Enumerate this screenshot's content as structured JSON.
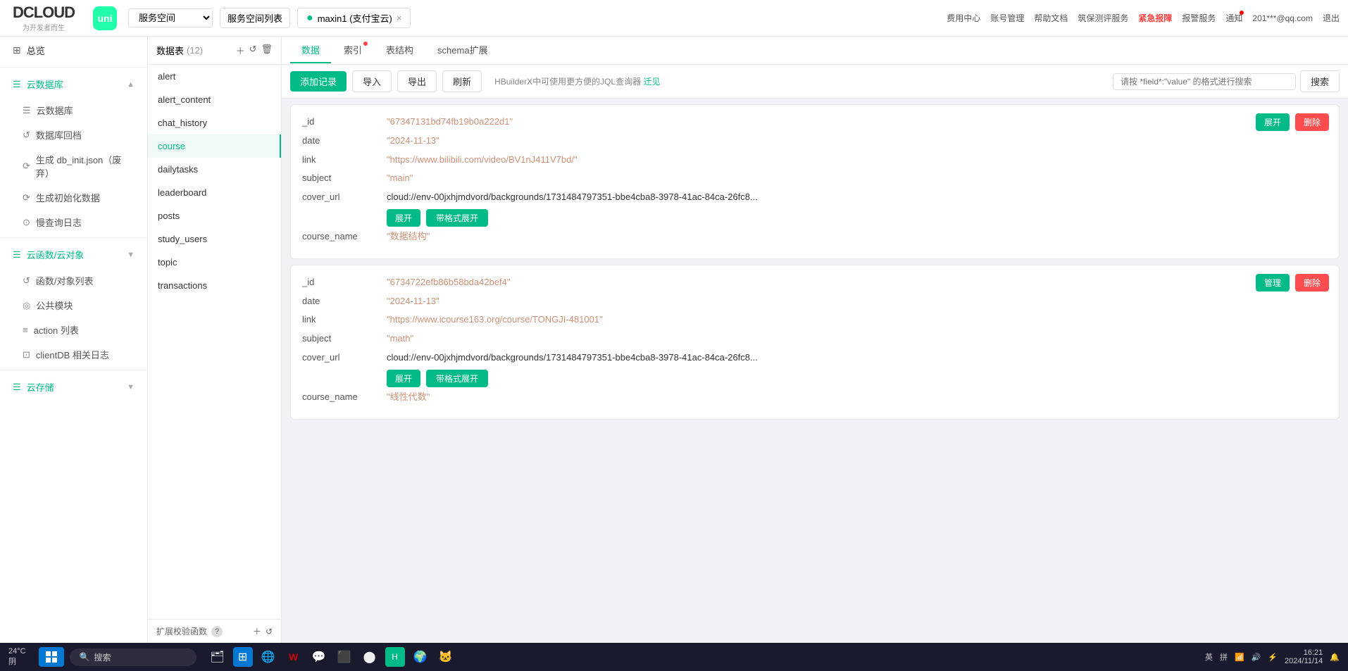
{
  "topbar": {
    "logo": "DCLOUD",
    "logo_sub": "为开发者而生",
    "uni_label": "uni",
    "workspace_label": "服务空间",
    "space_list_btn": "服务空间列表",
    "tab_active": "maxin1 (支付宝云)",
    "tab_close": "×",
    "nav_items": [
      "费用中心",
      "账号管理",
      "帮助文档",
      "筑保测评服务",
      "紧急报障",
      "报警服务",
      "通知",
      "201***@qq.com",
      "退出"
    ],
    "urgent_label": "紧急报障"
  },
  "sidebar": {
    "overview": "总览",
    "cloud_db_section": "云数据库",
    "cloud_db_label": "云数据库",
    "db_backup": "数据库回档",
    "gen_db_init": "生成 db_init.json（废弃）",
    "gen_init_data": "生成初始化数据",
    "slow_query_log": "慢查询日志",
    "cloud_func_section": "云函数/云对象",
    "func_list": "函数/对象列表",
    "public_module": "公共模块",
    "action_list": "action 列表",
    "client_db_log": "clientDB 相关日志",
    "cloud_storage": "云存储"
  },
  "table_list": {
    "header": "数据表",
    "count": "(12)",
    "tables": [
      "alert",
      "alert_content",
      "chat_history",
      "course",
      "dailytasks",
      "leaderboard",
      "posts",
      "study_users",
      "topic",
      "transactions"
    ],
    "active_table": "course",
    "expand_func_label": "扩展校验函数",
    "help_icon": "?"
  },
  "tabs": [
    {
      "label": "数据",
      "active": true,
      "has_dot": false
    },
    {
      "label": "索引",
      "active": false,
      "has_dot": true
    },
    {
      "label": "表结构",
      "active": false,
      "has_dot": false
    },
    {
      "label": "schema扩展",
      "active": false,
      "has_dot": false
    }
  ],
  "toolbar": {
    "add_record": "添加记录",
    "import": "导入",
    "export": "导出",
    "refresh": "刷新",
    "hint": "HBuilderX中可使用更方便的JQL查询器",
    "hint_link": "迁见",
    "search_placeholder": "请按 *field*:\"value\" 的格式进行搜索",
    "search_btn": "搜索"
  },
  "records": [
    {
      "id": "_id",
      "id_val": "\"67347131bd74fb19b0a222d1\"",
      "fields": [
        {
          "key": "date",
          "value": "\"2024-11-13\""
        },
        {
          "key": "link",
          "value": "\"https://www.bilibili.com/video/BV1nJ411V7bd/\""
        },
        {
          "key": "subject",
          "value": "\"main\""
        },
        {
          "key": "cover_url",
          "value": "cloud://env-00jxhjmdvord/backgrounds/1731484797351-bbe4cba8-3978-41ac-84ca-26fc8..."
        }
      ],
      "expand_btn": "展开",
      "expand_fmt_btn": "带格式展开",
      "course_name_key": "course_name",
      "course_name_val": "\"数据结构\""
    },
    {
      "id": "_id",
      "id_val": "\"6734722efb86b58bda42bef4\"",
      "fields": [
        {
          "key": "date",
          "value": "\"2024-11-13\""
        },
        {
          "key": "link",
          "value": "\"https://www.icourse163.org/course/TONGJI-481001\""
        },
        {
          "key": "subject",
          "value": "\"math\""
        },
        {
          "key": "cover_url",
          "value": "cloud://env-00jxhjmdvord/backgrounds/1731484797351-bbe4cba8-3978-41ac-84ca-26fc8..."
        }
      ],
      "expand_btn": "展开",
      "expand_fmt_btn": "带格式展开",
      "course_name_key": "course_name",
      "course_name_val": "\"线性代数\""
    }
  ],
  "taskbar": {
    "weather": "24°C",
    "weather_condition": "阴",
    "search_label": "搜索",
    "time": "16:21",
    "date": "2024/11/14",
    "input_method_en": "英",
    "input_method_cn": "拼"
  }
}
